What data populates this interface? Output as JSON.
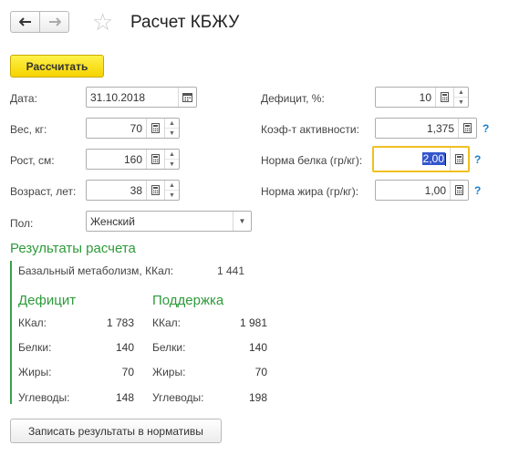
{
  "header": {
    "back_icon": "arrow-left-icon",
    "forward_icon": "arrow-right-icon",
    "favorite_icon": "star-icon",
    "title": "Расчет КБЖУ"
  },
  "toolbar": {
    "calculate_label": "Рассчитать"
  },
  "left_fields": {
    "date": {
      "label": "Дата:",
      "value": "31.10.2018"
    },
    "weight": {
      "label": "Вес, кг:",
      "value": "70"
    },
    "height": {
      "label": "Рост, см:",
      "value": "160"
    },
    "age": {
      "label": "Возраст, лет:",
      "value": "38"
    },
    "gender": {
      "label": "Пол:",
      "value": "Женский"
    }
  },
  "right_fields": {
    "deficit": {
      "label": "Дефицит, %:",
      "value": "10"
    },
    "activity": {
      "label": "Коэф-т активности:",
      "value": "1,375",
      "help": "?"
    },
    "protein": {
      "label": "Норма белка (гр/кг):",
      "value": "2,00",
      "help": "?"
    },
    "fat": {
      "label": "Норма жира (гр/кг):",
      "value": "1,00",
      "help": "?"
    }
  },
  "results": {
    "title": "Результаты расчета",
    "bmr_label": "Базальный метаболизм, ККал:",
    "bmr_value": "1 441",
    "deficit": {
      "title": "Дефицит",
      "rows": [
        {
          "label": "ККал:",
          "value": "1 783"
        },
        {
          "label": "Белки:",
          "value": "140"
        },
        {
          "label": "Жиры:",
          "value": "70"
        },
        {
          "label": "Углеводы:",
          "value": "148"
        }
      ]
    },
    "support": {
      "title": "Поддержка",
      "rows": [
        {
          "label": "ККал:",
          "value": "1 981"
        },
        {
          "label": "Белки:",
          "value": "140"
        },
        {
          "label": "Жиры:",
          "value": "70"
        },
        {
          "label": "Углеводы:",
          "value": "198"
        }
      ]
    }
  },
  "footer": {
    "save_label": "Записать результаты в нормативы"
  },
  "colors": {
    "accent_green": "#2e9a3a",
    "button_yellow": "#f5d300",
    "help_blue": "#1a7fd0",
    "focus_border": "#f0c020"
  }
}
